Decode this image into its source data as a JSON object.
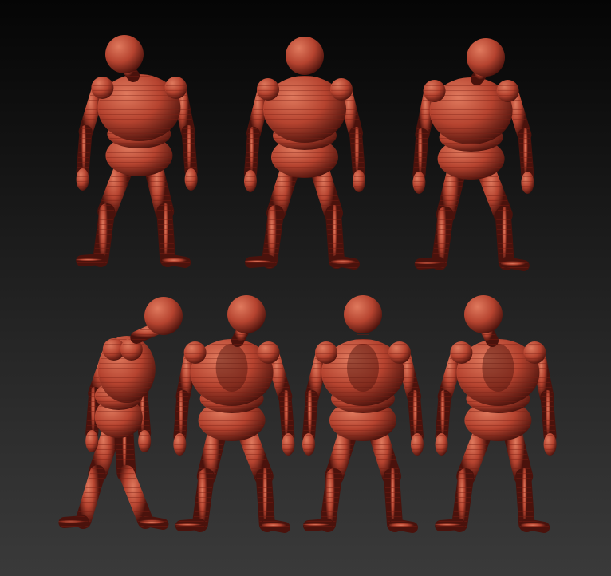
{
  "viewport": {
    "background_top": "#050505",
    "background_bottom": "#3a3a3a"
  },
  "model": {
    "material_color": "#b5432f",
    "highlight_color": "#e07a5e",
    "shadow_color": "#4a120c",
    "band_color": "#7a1f14"
  },
  "views": [
    {
      "name": "figure-front-three-quarter-left",
      "row": "top"
    },
    {
      "name": "figure-front",
      "row": "top"
    },
    {
      "name": "figure-front-three-quarter-right",
      "row": "top"
    },
    {
      "name": "figure-side-left",
      "row": "bottom"
    },
    {
      "name": "figure-back-three-quarter-left",
      "row": "bottom"
    },
    {
      "name": "figure-back",
      "row": "bottom"
    },
    {
      "name": "figure-back-three-quarter-right",
      "row": "bottom"
    }
  ]
}
